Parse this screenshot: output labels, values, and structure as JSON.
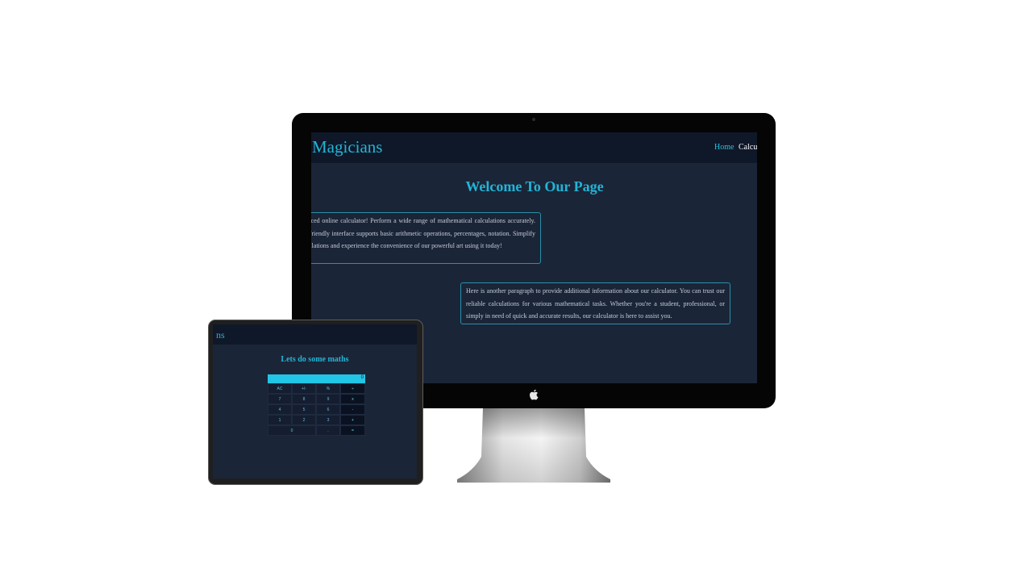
{
  "desktop": {
    "brand": "Magicians",
    "nav": {
      "home": "Home",
      "calculator": "Calcul"
    },
    "heading": "Welcome To Our Page",
    "paragraph_1": "our advanced online calculator! Perform a wide range of mathematical calculations accurately. Our user-friendly interface supports basic arithmetic operations, percentages, notation. Simplify your calculations and experience the convenience of our powerful art using it today!",
    "paragraph_2": "Here is another paragraph to provide additional information about our calculator. You can trust our reliable calculations for various mathematical tasks. Whether you're a student, professional, or simply in need of quick and accurate results, our calculator is here to assist you."
  },
  "tablet": {
    "brand": "ns",
    "heading": "Lets do some maths",
    "display_value": "0",
    "keys": {
      "ac": "AC",
      "plus_minus": "+/-",
      "percent": "%",
      "divide": "÷",
      "seven": "7",
      "eight": "8",
      "nine": "9",
      "multiply": "x",
      "four": "4",
      "five": "5",
      "six": "6",
      "minus": "-",
      "one": "1",
      "two": "2",
      "three": "3",
      "plus": "+",
      "zero": "0",
      "dot": ".",
      "equals": "="
    }
  },
  "colors": {
    "page_background": "#1b2538",
    "nav_background": "#0f1829",
    "accent": "#22b5d6",
    "display": "#22c5e3"
  },
  "icons": {
    "logo": "apple-logo-icon"
  }
}
